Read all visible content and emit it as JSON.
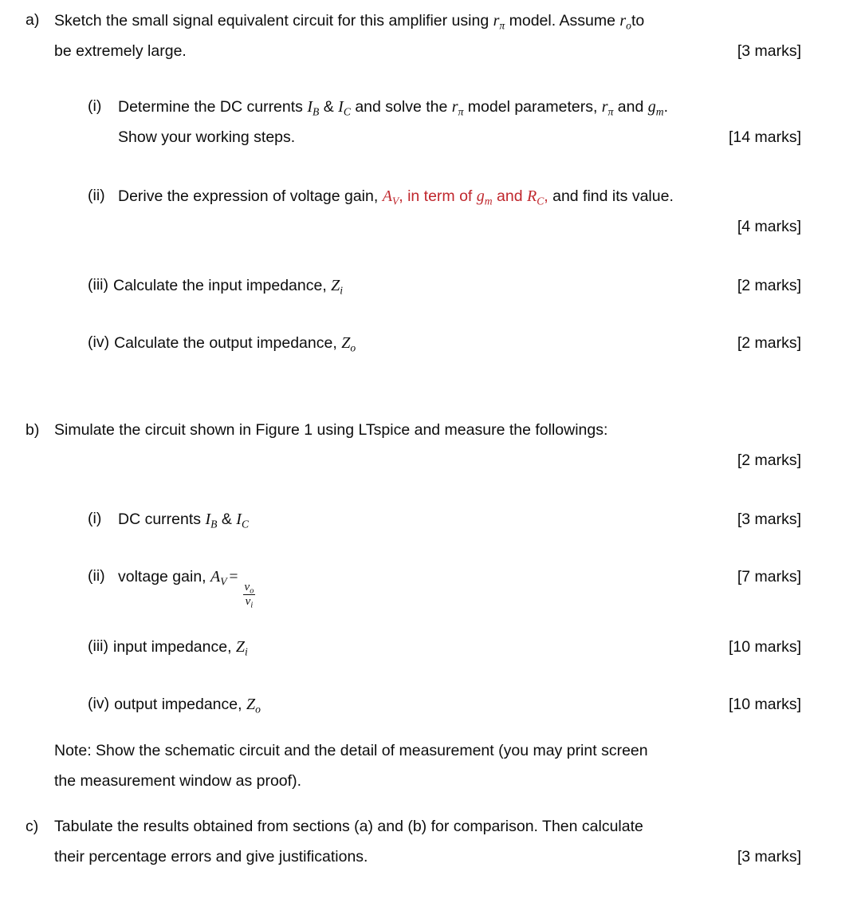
{
  "document": {
    "type": "exam-question-sheet",
    "text_color": "#0d0d0d",
    "accent_color": "#c0272d",
    "background": "#ffffff"
  },
  "items": {
    "a": {
      "marker": "a)",
      "line1_pre": "Sketch the small signal equivalent circuit for this amplifier using ",
      "sym_rpi": "r",
      "sym_rpi_sub": "π",
      "line1_mid": " model. Assume ",
      "sym_ro": "r",
      "sym_ro_sub": "o",
      "line1_post": "to",
      "line2": "be extremely large.",
      "marks": "[3 marks]"
    },
    "a_i": {
      "marker": "(i)",
      "t1": "Determine the DC currents ",
      "sym_IB": "I",
      "sym_IB_sub": "B",
      "t2": " & ",
      "sym_IC": "I",
      "sym_IC_sub": "C",
      "t3": " and solve the ",
      "sym_rpi": "r",
      "sym_rpi_sub": "π",
      "t4": " model parameters, ",
      "sym_rpi2": "r",
      "sym_rpi2_sub": "π",
      "t5": " and ",
      "sym_gm": "g",
      "sym_gm_sub": "m",
      "t6": ".",
      "line2": "Show your working steps.",
      "marks": "[14 marks]"
    },
    "a_ii": {
      "marker": "(ii)",
      "t1": "Derive the expression of voltage gain, ",
      "sym_AV": "A",
      "sym_AV_sub": "V",
      "t2_red": ", in term of ",
      "sym_gm": "g",
      "sym_gm_sub": "m",
      "t3_red": " and ",
      "sym_RC": "R",
      "sym_RC_sub": "C",
      "t4_red": ",",
      "t5": " and find its value.",
      "marks": "[4 marks]"
    },
    "a_iii": {
      "marker": "(iii)",
      "t1": "Calculate the input impedance, ",
      "sym_Zi": "Z",
      "sym_Zi_sub": "i",
      "marks": "[2 marks]"
    },
    "a_iv": {
      "marker": "(iv)",
      "t1": "Calculate the output impedance, ",
      "sym_Zo": "Z",
      "sym_Zo_sub": "o",
      "marks": "[2 marks]"
    },
    "b": {
      "marker": "b)",
      "line1": "Simulate the circuit shown in Figure 1 using LTspice and measure the followings:",
      "marks": "[2 marks]"
    },
    "b_i": {
      "marker": "(i)",
      "t1": "DC currents ",
      "sym_IB": "I",
      "sym_IB_sub": "B",
      "t2": " & ",
      "sym_IC": "I",
      "sym_IC_sub": "C",
      "marks": "[3 marks]"
    },
    "b_ii": {
      "marker": "(ii)",
      "t1": "voltage gain, ",
      "sym_AV": "A",
      "sym_AV_sub": "V",
      "equals": "=",
      "frac_num": "v",
      "frac_num_sub": "o",
      "frac_den": "v",
      "frac_den_sub": "i",
      "marks": "[7 marks]"
    },
    "b_iii": {
      "marker": "(iii)",
      "t1": "input impedance, ",
      "sym_Zi": "Z",
      "sym_Zi_sub": "i",
      "marks": "[10 marks]"
    },
    "b_iv": {
      "marker": "(iv)",
      "t1": "output impedance, ",
      "sym_Zo": "Z",
      "sym_Zo_sub": "o",
      "marks": "[10 marks]"
    },
    "note": {
      "line1": "Note: Show the schematic circuit and the detail of measurement (you may print screen",
      "line2": "the measurement window as proof)."
    },
    "c": {
      "marker": "c)",
      "line1": "Tabulate the results obtained from sections (a) and (b) for comparison. Then calculate",
      "line2": "their percentage errors and give justifications.",
      "marks": "[3 marks]"
    }
  }
}
